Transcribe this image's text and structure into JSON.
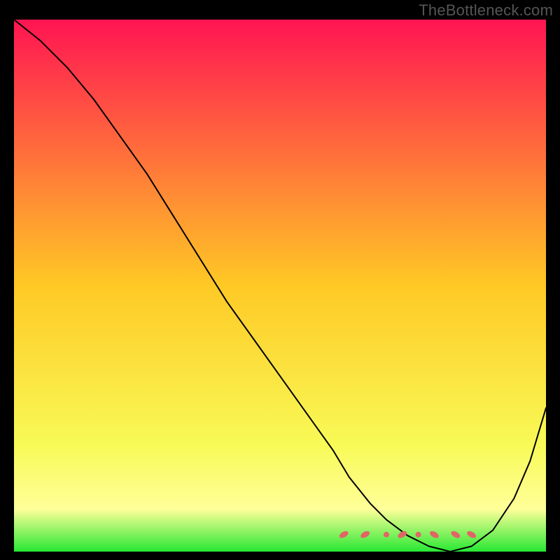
{
  "watermark": "TheBottleneck.com",
  "chart_data": {
    "type": "line",
    "title": "",
    "xlabel": "",
    "ylabel": "",
    "xlim": [
      0,
      100
    ],
    "ylim": [
      0,
      100
    ],
    "grid": false,
    "legend": false,
    "background_gradient": {
      "stops": [
        {
          "offset": 0.0,
          "color": "#ff1452"
        },
        {
          "offset": 0.5,
          "color": "#ffc925"
        },
        {
          "offset": 0.8,
          "color": "#f8fa57"
        },
        {
          "offset": 0.92,
          "color": "#ffff99"
        },
        {
          "offset": 1.0,
          "color": "#27e833"
        }
      ]
    },
    "series": [
      {
        "name": "bottleneck-curve",
        "color": "#000000",
        "stroke_width": 2,
        "x": [
          0,
          5,
          10,
          15,
          20,
          25,
          30,
          35,
          40,
          45,
          50,
          55,
          60,
          63,
          67,
          70,
          74,
          78,
          82,
          86,
          90,
          94,
          97,
          100
        ],
        "y": [
          100,
          96,
          91,
          85,
          78,
          71,
          63,
          55,
          47,
          40,
          33,
          26,
          19,
          14,
          9,
          6,
          3,
          1,
          0,
          1,
          4,
          10,
          17,
          27
        ]
      }
    ],
    "markers": {
      "name": "optimal-band",
      "color": "#e06666",
      "radius_short": 4,
      "radius_long": 7,
      "y": 3.2,
      "points": [
        {
          "x": 62,
          "shape": "dash"
        },
        {
          "x": 66,
          "shape": "dash"
        },
        {
          "x": 70,
          "shape": "dot"
        },
        {
          "x": 73,
          "shape": "dash"
        },
        {
          "x": 76,
          "shape": "dot"
        },
        {
          "x": 79,
          "shape": "dash"
        },
        {
          "x": 83,
          "shape": "dash"
        },
        {
          "x": 86,
          "shape": "dash"
        }
      ]
    }
  }
}
